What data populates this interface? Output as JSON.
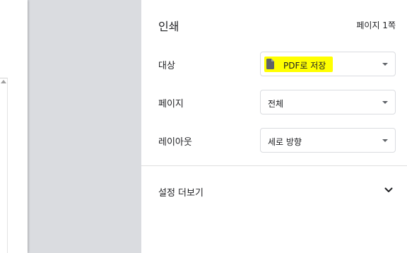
{
  "panel": {
    "title": "인쇄",
    "page_count": "페이지 1쪽"
  },
  "destination": {
    "label": "대상",
    "value": "PDF로 저장",
    "icon": "file-icon",
    "highlight_color": "#ffff00"
  },
  "pages": {
    "label": "페이지",
    "value": "전체"
  },
  "layout": {
    "label": "레이아웃",
    "value": "세로 방향"
  },
  "more_settings": {
    "label": "설정 더보기",
    "icon": "chevron-down-icon"
  },
  "colors": {
    "preview_background": "#dadce0",
    "border": "#dadce0",
    "text": "#202124",
    "arrow": "#5f6368"
  }
}
